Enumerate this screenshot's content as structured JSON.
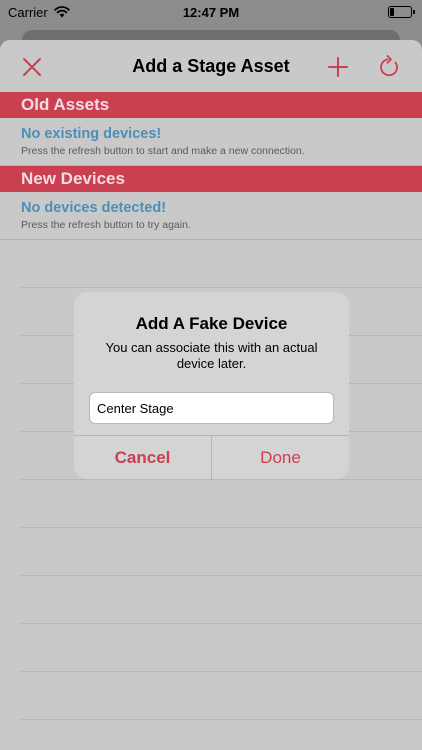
{
  "status": {
    "carrier": "Carrier",
    "time": "12:47 PM",
    "battery_level": 0.2
  },
  "nav": {
    "title": "Add a Stage Asset",
    "close_icon": "close-icon",
    "add_icon": "plus-icon",
    "refresh_icon": "refresh-icon"
  },
  "sections": {
    "old": {
      "header": "Old Assets",
      "title": "No existing devices!",
      "subtitle": "Press the refresh button to start and make a new connection."
    },
    "new": {
      "header": "New Devices",
      "title": "No devices detected!",
      "subtitle": "Press the refresh button to try again."
    }
  },
  "alert": {
    "title": "Add A Fake Device",
    "message": "You can associate this with an actual device later.",
    "input_value": "Center Stage",
    "cancel_label": "Cancel",
    "done_label": "Done"
  },
  "colors": {
    "accent": "#c94050",
    "link": "#4b8fb8"
  }
}
